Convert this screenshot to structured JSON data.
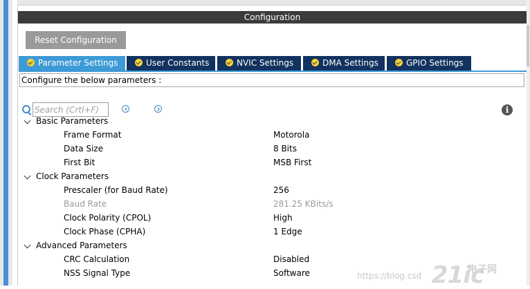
{
  "header": {
    "title": "Configuration"
  },
  "toolbar": {
    "reset_label": "Reset Configuration"
  },
  "tabs": [
    {
      "label": "Parameter Settings",
      "active": true
    },
    {
      "label": "User Constants"
    },
    {
      "label": "NVIC Settings"
    },
    {
      "label": "DMA Settings"
    },
    {
      "label": "GPIO Settings"
    }
  ],
  "config_prompt": "Configure the below parameters :",
  "search": {
    "placeholder": "Search (Crtl+F)"
  },
  "groups": [
    {
      "label": "Basic Parameters",
      "params": [
        {
          "name": "Frame Format",
          "value": "Motorola"
        },
        {
          "name": "Data Size",
          "value": "8 Bits"
        },
        {
          "name": "First Bit",
          "value": "MSB First"
        }
      ]
    },
    {
      "label": "Clock Parameters",
      "params": [
        {
          "name": "Prescaler (for Baud Rate)",
          "value": "256"
        },
        {
          "name": "Baud Rate",
          "value": "281.25 KBits/s",
          "disabled": true
        },
        {
          "name": "Clock Polarity (CPOL)",
          "value": "High"
        },
        {
          "name": "Clock Phase (CPHA)",
          "value": "1 Edge"
        }
      ]
    },
    {
      "label": "Advanced Parameters",
      "params": [
        {
          "name": "CRC Calculation",
          "value": "Disabled"
        },
        {
          "name": "NSS Signal Type",
          "value": "Software"
        }
      ]
    }
  ],
  "watermark": {
    "url": "https://blog.csd",
    "logo": "21ic",
    "cn_line1": "电子网",
    "cn_line2": ""
  },
  "colors": {
    "tab_active": "#3c9ad6",
    "tab_inactive": "#12325f",
    "header_bg": "#3b3b3b",
    "accent_blue": "#4a90d4"
  }
}
